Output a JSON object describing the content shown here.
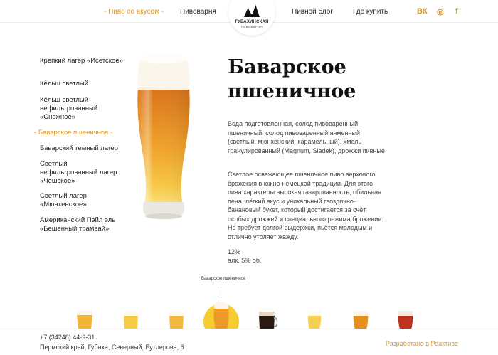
{
  "header": {
    "nav": [
      {
        "label": "Пиво со вкусом",
        "active": true
      },
      {
        "label": "Пивоварня",
        "active": false
      },
      {
        "label": "Пивной блог",
        "active": false
      },
      {
        "label": "Где купить",
        "active": false
      }
    ],
    "logo": {
      "name": "ГУБАХИНСКАЯ",
      "sub": "ПИВОВАРНЯ"
    },
    "social": [
      {
        "name": "vk-icon",
        "glyph": "ВК"
      },
      {
        "name": "instagram-icon",
        "glyph": "◎"
      },
      {
        "name": "facebook-icon",
        "glyph": "f"
      }
    ]
  },
  "sidebar": {
    "items": [
      {
        "label": "Крепкий лагер «Исетское»",
        "active": false
      },
      {
        "label": "Кёльш светлый",
        "active": false
      },
      {
        "label": "Кёльш светлый нефильтрованный «Снежное»",
        "active": false
      },
      {
        "label": "Баварское пшеничное",
        "active": true
      },
      {
        "label": "Баварский темный лагер",
        "active": false
      },
      {
        "label": "Светлый нефильтрованный лагер «Чешское»",
        "active": false
      },
      {
        "label": "Светлый лагер «Мюнхенское»",
        "active": false
      },
      {
        "label": "Американский Пэйл эль «Бешенный трамвай»",
        "active": false
      }
    ]
  },
  "product": {
    "title": "Баварское пшеничное",
    "ingredients": "Вода подготовленная, солод пивоваренный пшеничный, солод пивоваренный ячменный (светлый, мюнхенский, карамельный), хмель гранулированный (Magnum, Sladek), дрожжи пивные",
    "description": "Светлое освежающее пшеничное пиво верхового брожения в южно-немецкой традиции. Для этого пива характеры высокая газированность, обильная пена, лёгкий вкус и уникальный гвоздично-банановый букет, который достигается за счёт особых дрожжей и специального режима брожения. Не требует долгой выдержки, пьётся молодым и отлично утоляет жажду.",
    "gravity": "12%",
    "abv": "алк. 5% об."
  },
  "carousel": {
    "selected_caption": "Баварское пшеничное",
    "accent": "#f6cc2f"
  },
  "footer": {
    "phone": "+7 (34248) 44-9-31",
    "address": "Пермский край, Губаха, Северный, Бутлерова, 6",
    "developer": "Разработано в Реактиве"
  },
  "colors": {
    "accent": "#d9962b",
    "text": "#222222"
  }
}
